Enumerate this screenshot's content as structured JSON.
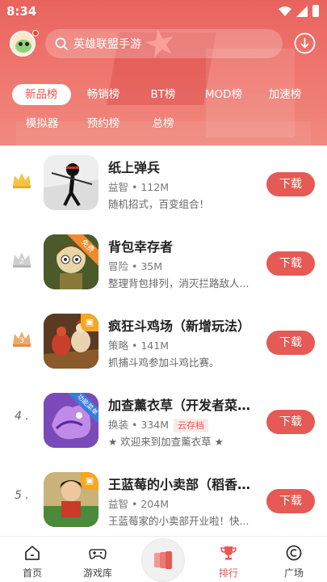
{
  "status_bar": {
    "time": "8:34"
  },
  "search": {
    "placeholder": "英雄联盟手游"
  },
  "tabs": [
    {
      "label": "新品榜",
      "active": true
    },
    {
      "label": "畅销榜",
      "active": false
    },
    {
      "label": "BT榜",
      "active": false
    },
    {
      "label": "MOD榜",
      "active": false
    },
    {
      "label": "加速榜",
      "active": false
    },
    {
      "label": "模拟器",
      "active": false
    },
    {
      "label": "预约榜",
      "active": false
    },
    {
      "label": "总榜",
      "active": false
    }
  ],
  "apps": [
    {
      "rank": "1",
      "name": "纸上弹兵",
      "category": "益智",
      "size": "112M",
      "tag": "",
      "desc": "随机招式，百变组合！",
      "button": "下载",
      "icon_ribbon": ""
    },
    {
      "rank": "2",
      "name": "背包幸存者",
      "category": "冒险",
      "size": "35M",
      "tag": "",
      "desc": "整理背包排列，消灭拦路敌人...",
      "button": "下载",
      "icon_ribbon": "免费"
    },
    {
      "rank": "3",
      "name": "疯狂斗鸡场（新增玩法）",
      "category": "策略",
      "size": "141M",
      "tag": "",
      "desc": "抓捕斗鸡参加斗鸡比赛。",
      "button": "下载",
      "icon_ribbon": ""
    },
    {
      "rank": "4",
      "name": "加查薰衣草（开发者菜单...",
      "category": "换装",
      "size": "334M",
      "tag": "云存档",
      "desc": "★ 欢迎来到加查薰衣草 ★",
      "button": "下载",
      "icon_ribbon": "功能菜单"
    },
    {
      "rank": "5",
      "name": "王蓝莓的小卖部（稻香场...",
      "category": "益智",
      "size": "204M",
      "tag": "",
      "desc": "王蓝莓家的小卖部开业啦！快...",
      "button": "下载",
      "icon_ribbon": ""
    }
  ],
  "meta_separator": " • ",
  "rank_suffix": " .",
  "bottom_nav": [
    {
      "label": "首页",
      "active": false
    },
    {
      "label": "游戏库",
      "active": false
    },
    {
      "label": "排行",
      "active": true
    },
    {
      "label": "广场",
      "active": false
    }
  ],
  "colors": {
    "accent": "#e55a54",
    "header_top": "#e9635e",
    "gold": "#f5c542",
    "silver": "#c9c9c9",
    "bronze": "#e8a96a"
  }
}
